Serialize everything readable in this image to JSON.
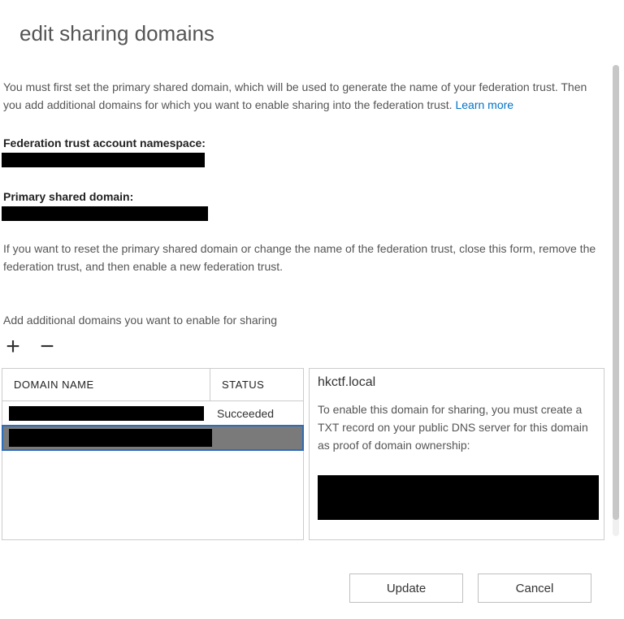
{
  "title": "edit sharing domains",
  "intro_text": "You must first set the primary shared domain, which will be used to generate the name of your federation trust. Then you add additional domains for which you want to enable sharing into the federation trust. ",
  "learn_more": "Learn more",
  "ns_label": "Federation trust account namespace:",
  "pd_label": "Primary shared domain:",
  "reset_note": "If you want to reset the primary shared domain or change the name of the federation trust, close this form, remove the federation trust, and then enable a new federation trust.",
  "add_label": "Add additional domains you want to enable for sharing",
  "toolbar": {
    "add": "+",
    "remove": "−"
  },
  "columns": {
    "name": "DOMAIN NAME",
    "status": "STATUS"
  },
  "rows": [
    {
      "domain": "",
      "status": "Succeeded",
      "selected": false
    },
    {
      "domain": "",
      "status": "",
      "selected": true
    }
  ],
  "detail": {
    "title": "hkctf.local",
    "text": "To enable this domain for sharing, you must create a TXT record on your public DNS server for this domain as proof of domain ownership:"
  },
  "buttons": {
    "update": "Update",
    "cancel": "Cancel"
  }
}
